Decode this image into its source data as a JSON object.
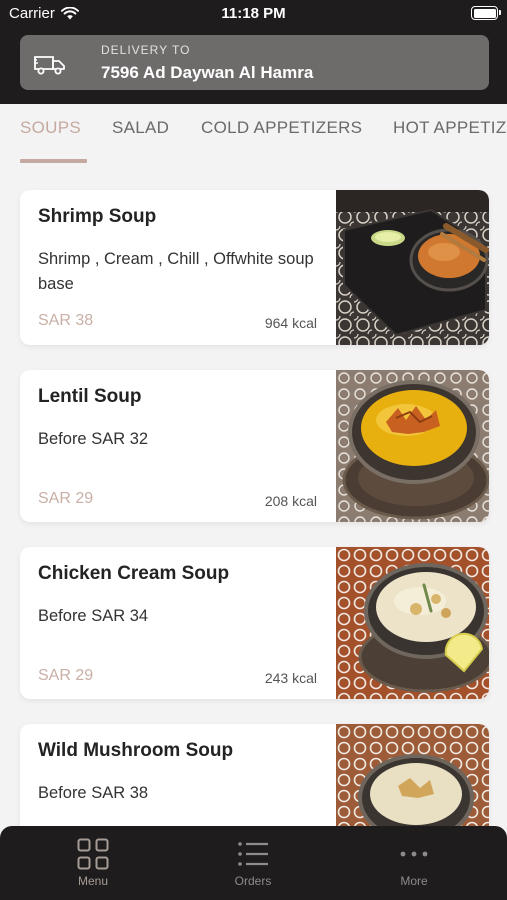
{
  "status_bar": {
    "carrier": "Carrier",
    "time": "11:18 PM"
  },
  "delivery": {
    "label": "DELIVERY TO",
    "address": "7596 Ad Daywan Al Hamra"
  },
  "tabs": [
    {
      "label": "SOUPS",
      "active": true
    },
    {
      "label": "SALAD",
      "active": false
    },
    {
      "label": "COLD APPETIZERS",
      "active": false
    },
    {
      "label": "HOT APPETIZERS",
      "active": false
    }
  ],
  "items": [
    {
      "name": "Shrimp Soup",
      "description": "Shrimp , Cream , Chill , Offwhite soup base",
      "price": "SAR 38",
      "kcal": "964 kcal",
      "image": "shrimp-soup-photo"
    },
    {
      "name": "Lentil Soup",
      "description": "Before SAR 32",
      "price": "SAR 29",
      "kcal": "208 kcal",
      "image": "lentil-soup-photo"
    },
    {
      "name": "Chicken Cream Soup",
      "description": "Before SAR 34",
      "price": "SAR 29",
      "kcal": "243 kcal",
      "image": "chicken-cream-soup-photo"
    },
    {
      "name": "Wild Mushroom Soup",
      "description": "Before SAR 38",
      "price": "",
      "kcal": "",
      "image": "wild-mushroom-soup-photo"
    }
  ],
  "bottom_nav": [
    {
      "label": "Menu",
      "icon": "grid-icon",
      "active": true
    },
    {
      "label": "Orders",
      "icon": "list-icon",
      "active": false
    },
    {
      "label": "More",
      "icon": "more-dots-icon",
      "active": false
    }
  ],
  "colors": {
    "accent": "#c4a9a1",
    "header_bg": "#1f1c1d",
    "delivery_bg": "#6e6b6b",
    "page_bg": "#f4f3f3"
  }
}
